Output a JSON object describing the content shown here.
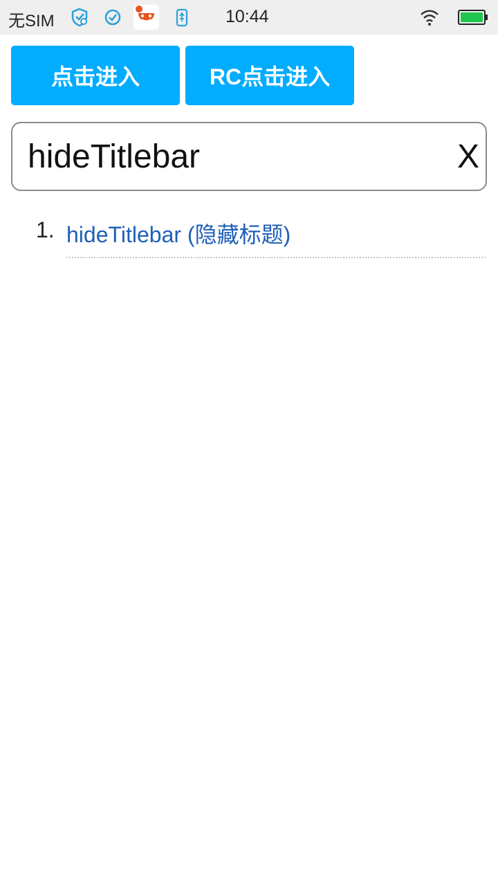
{
  "status_bar": {
    "carrier": "无SIM",
    "time": "10:44",
    "icons": [
      "shield-icon",
      "check-circle-icon",
      "app-notification-icon",
      "usb-icon",
      "wifi-icon",
      "battery-icon"
    ],
    "battery_color": "#1ec64d"
  },
  "actions": {
    "enter_label": "点击进入",
    "rc_enter_label": "RC点击进入",
    "button_color": "#02acfe"
  },
  "search": {
    "value": "hideTitlebar",
    "clear_label": "X"
  },
  "results": [
    {
      "index": "1.",
      "label": "hideTitlebar (隐藏标题)"
    }
  ],
  "colors": {
    "link": "#1f5fb8"
  }
}
